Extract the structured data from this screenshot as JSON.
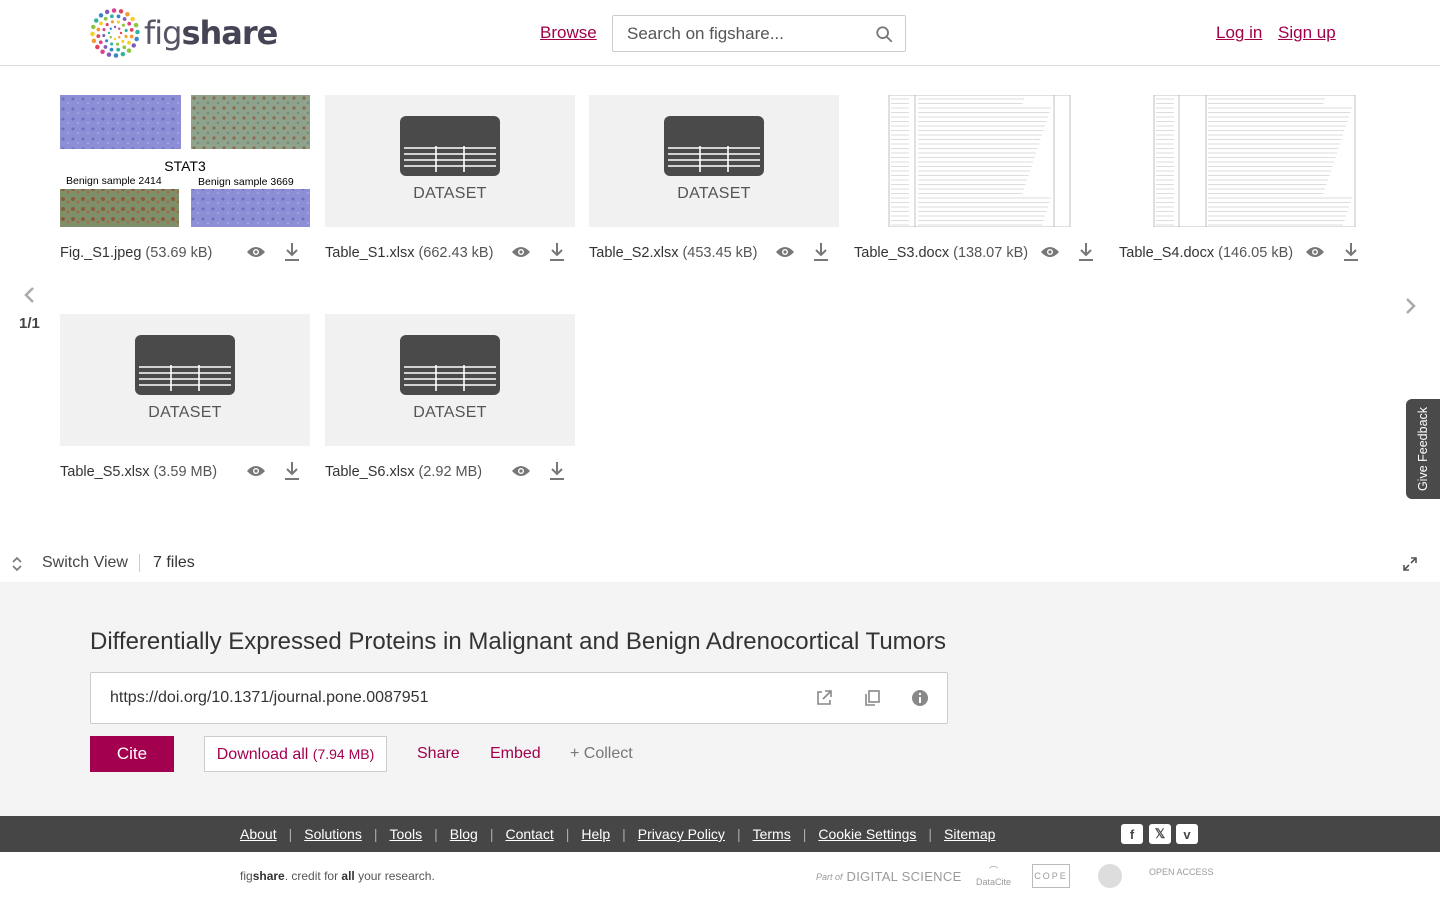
{
  "header": {
    "logo_text_light": "fig",
    "logo_text_bold": "share",
    "browse": "Browse",
    "search_placeholder": "Search on figshare...",
    "login": "Log in",
    "signup": "Sign up"
  },
  "files": {
    "pager": "1/1",
    "items": [
      {
        "name": "Fig._S1.jpeg",
        "size": "(53.69 kB)",
        "kind": "image"
      },
      {
        "name": "Table_S1.xlsx",
        "size": "(662.43 kB)",
        "kind": "dataset",
        "label": "DATASET"
      },
      {
        "name": "Table_S2.xlsx",
        "size": "(453.45 kB)",
        "kind": "dataset",
        "label": "DATASET"
      },
      {
        "name": "Table_S3.docx",
        "size": "(138.07 kB)",
        "kind": "document"
      },
      {
        "name": "Table_S4.docx",
        "size": "(146.05 kB)",
        "kind": "document"
      },
      {
        "name": "Table_S5.xlsx",
        "size": "(3.59 MB)",
        "kind": "dataset",
        "label": "DATASET"
      },
      {
        "name": "Table_S6.xlsx",
        "size": "(2.92 MB)",
        "kind": "dataset",
        "label": "DATASET"
      }
    ],
    "image_thumb": {
      "heading": "STAT3",
      "label_left": "Benign sample 2414",
      "label_right": "Benign sample 3669"
    },
    "switch_view": "Switch View",
    "count": "7 files",
    "feedback": "Give Feedback"
  },
  "meta": {
    "title": "Differentially Expressed Proteins in Malignant and Benign Adrenocortical Tumors",
    "doi": "https://doi.org/10.1371/journal.pone.0087951",
    "cite": "Cite",
    "download_all": "Download all",
    "download_size": "(7.94 MB)",
    "share": "Share",
    "embed": "Embed",
    "collect": "+ Collect"
  },
  "footer": {
    "links": [
      "About",
      "Solutions",
      "Tools",
      "Blog",
      "Contact",
      "Help",
      "Privacy Policy",
      "Terms",
      "Cookie Settings",
      "Sitemap"
    ],
    "tagline_brand_light": "fig",
    "tagline_brand_bold": "share",
    "tagline_mid": ". credit for ",
    "tagline_all": "all",
    "tagline_end": " your research.",
    "partner_part_of": "Part of",
    "partner_ds": "DIGITAL SCIENCE",
    "partner_datacite": "DataCite",
    "partner_cope": "COPE",
    "partner_oa": "OPEN ACCESS"
  },
  "colors": {
    "brand": "#a3014f",
    "footer_bg": "#464646",
    "meta_bg": "#f4f4f4",
    "tile_bg": "#f1f1f1"
  }
}
